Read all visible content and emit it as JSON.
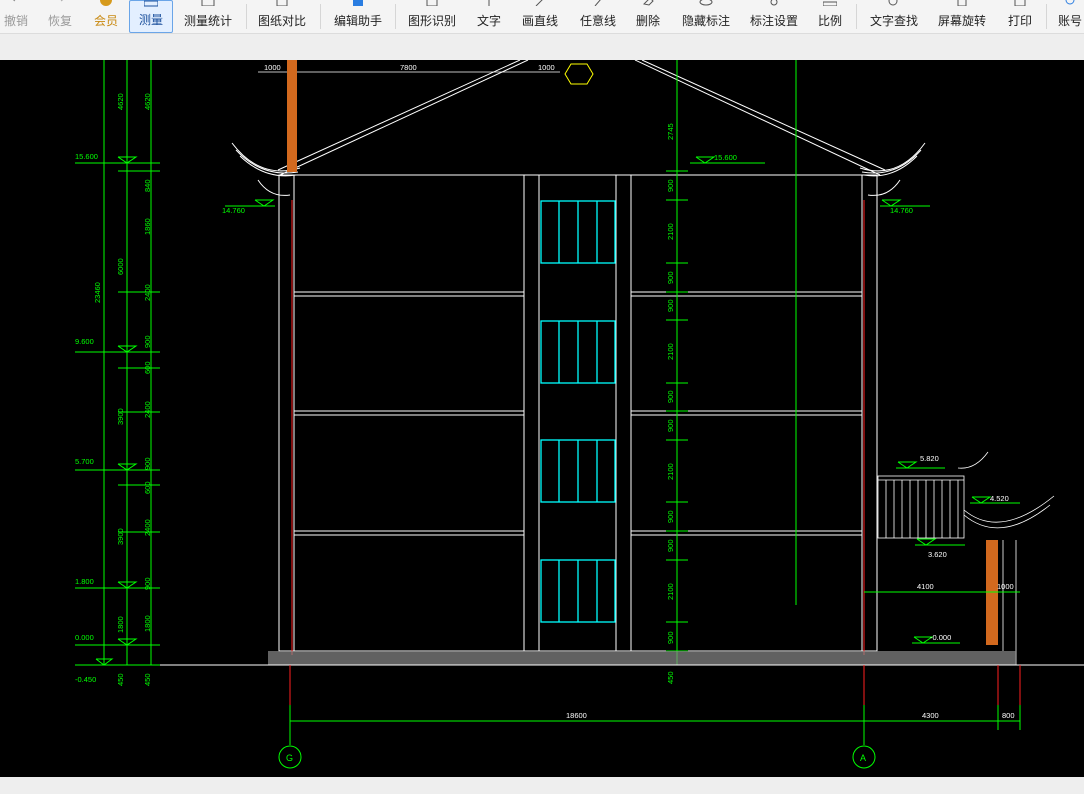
{
  "toolbar": {
    "undo": "撤销",
    "redo": "恢复",
    "vip": "会员",
    "measure": "测量",
    "measure_stats": "测量统计",
    "drawing_compare": "图纸对比",
    "edit_assistant": "编辑助手",
    "shape_recognition": "图形识别",
    "text": "文字",
    "draw_line": "画直线",
    "free_line": "任意线",
    "delete": "删除",
    "hide_annotation": "隐藏标注",
    "annotation_settings": "标注设置",
    "scale": "比例",
    "text_search": "文字查找",
    "screen_rotate": "屏幕旋转",
    "print": "打印",
    "account": "账号"
  },
  "drawing": {
    "top_dims": [
      "1000",
      "7800",
      "1000"
    ],
    "left_outer": [
      "4620",
      "23460",
      "450"
    ],
    "left_mid": [
      "4620",
      "6000",
      "3900",
      "3900",
      "1800",
      "450"
    ],
    "left_inner": [
      "840",
      "1860",
      "2400",
      "900",
      "600",
      "2400",
      "900",
      "600",
      "2400",
      "900",
      "1800",
      "450"
    ],
    "levels": [
      "15.600",
      "9.600",
      "5.700",
      "1.800",
      "0.000",
      "-0.450"
    ],
    "roof_levels": [
      "15.600",
      "14.760",
      "14.760"
    ],
    "center_dims": [
      "2745",
      "900",
      "2100",
      "900",
      "900",
      "2100",
      "900",
      "900",
      "2100",
      "900",
      "900",
      "2100",
      "900",
      "450"
    ],
    "annex_levels": [
      "5.820",
      "4.520",
      "3.620",
      "-0.000"
    ],
    "annex_dims": [
      "4100",
      "1000"
    ],
    "bottom_dims": [
      "18600",
      "4300",
      "800"
    ],
    "axes": [
      "G",
      "A"
    ]
  },
  "colors": {
    "green": "#00ff00",
    "cyan": "#00ffff",
    "white": "#ffffff",
    "orange": "#d2691e",
    "red": "#ff2020",
    "yellow": "#ffff00"
  }
}
